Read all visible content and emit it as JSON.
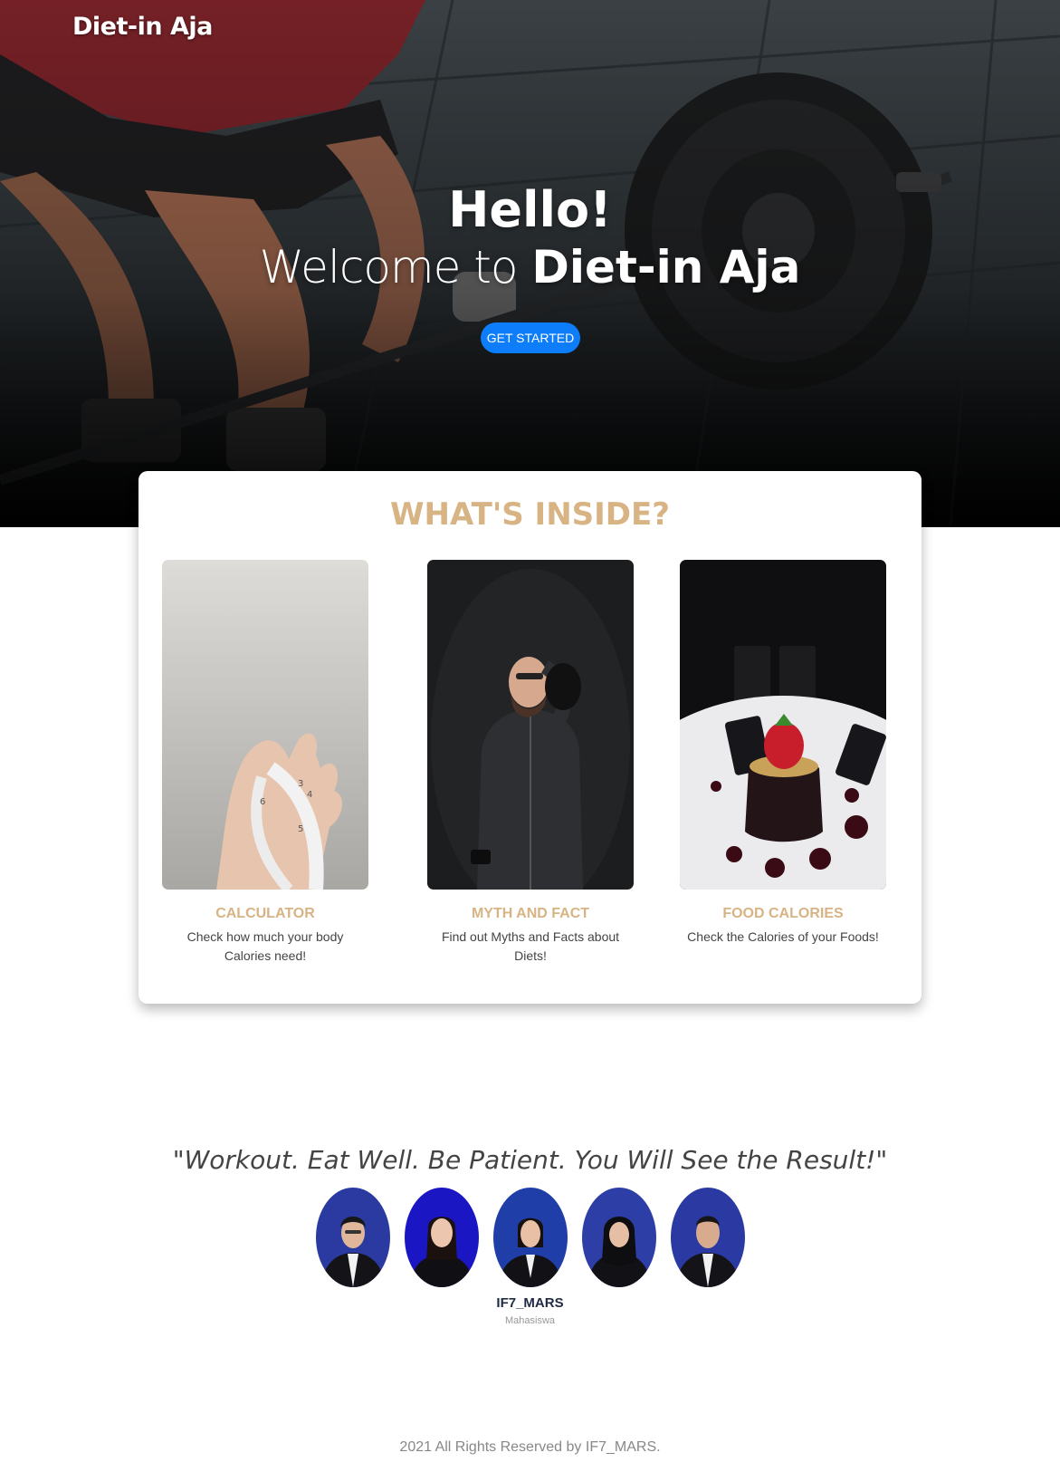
{
  "header": {
    "brand": "Diet-in Aja"
  },
  "hero": {
    "greeting": "Hello!",
    "welcome_prefix": "Welcome to",
    "welcome_brand": "Diet-in Aja",
    "cta_label": "GET STARTED"
  },
  "inside": {
    "title": "WHAT'S INSIDE?",
    "features": [
      {
        "title": "CALCULATOR",
        "description": "Check how much your body Calories need!",
        "image": "hand-measuring-tape-photo"
      },
      {
        "title": "MYTH AND FACT",
        "description": "Find out Myths and Facts about Diets!",
        "image": "man-thinking-photo"
      },
      {
        "title": "FOOD CALORIES",
        "description": "Check the Calories of your Foods!",
        "image": "chocolate-cake-photo"
      }
    ]
  },
  "quote": "\"Workout. Eat Well. Be Patient. You Will See the Result!\"",
  "team": {
    "name": "IF7_MARS",
    "role": "Mahasiswa",
    "member_count": 5
  },
  "footer": {
    "copyright": "2021 All Rights Reserved by IF7_MARS."
  },
  "colors": {
    "accent": "#d8b384",
    "button": "#0d7dfa",
    "team_name": "#1f2a44"
  }
}
